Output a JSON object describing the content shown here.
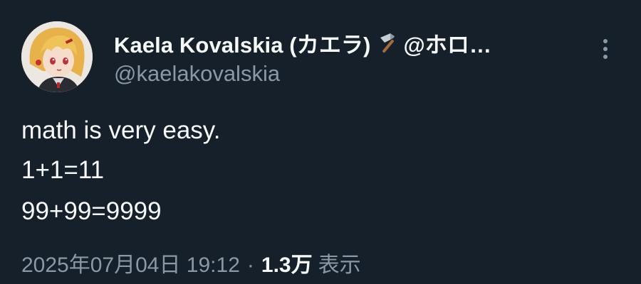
{
  "author": {
    "display_name": "Kaela Kovalskia (カエラ)",
    "emoji_icon": "hammer-icon",
    "display_name_suffix": "@ホロ…",
    "handle": "@kaelakovalskia"
  },
  "tweet": {
    "lines": [
      "math is very easy.",
      "1+1=11",
      "99+99=9999"
    ],
    "timestamp": "2025年07月04日 19:12",
    "separator": "·",
    "views_count": "1.3万",
    "views_label": "表示"
  },
  "colors": {
    "background": "#15202b",
    "primary_text": "#f7f9f9",
    "secondary_text": "#8b98a5"
  }
}
